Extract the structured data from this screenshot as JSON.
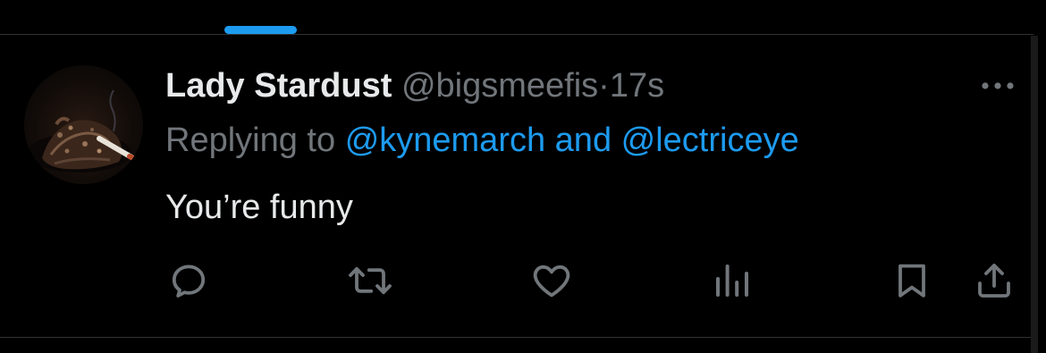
{
  "tweet": {
    "display_name": "Lady Stardust",
    "handle": "@bigsmeefis",
    "separator": "·",
    "time": "17s",
    "reply_prefix": "Replying to",
    "reply_mention_1": "@kynemarch",
    "reply_conjunction": "and",
    "reply_mention_2": "@lectriceye",
    "text": "You’re funny"
  },
  "icons": {
    "more": "more-horizontal-icon",
    "reply": "reply-bubble-icon",
    "retweet": "retweet-icon",
    "like": "heart-icon",
    "views": "views-bar-chart-icon",
    "bookmark": "bookmark-icon",
    "share": "share-upload-icon"
  },
  "colors": {
    "background": "#000000",
    "primary_text": "#e7e9ea",
    "secondary_text": "#71767b",
    "accent": "#1d9bf0",
    "divider": "#2f3336"
  }
}
